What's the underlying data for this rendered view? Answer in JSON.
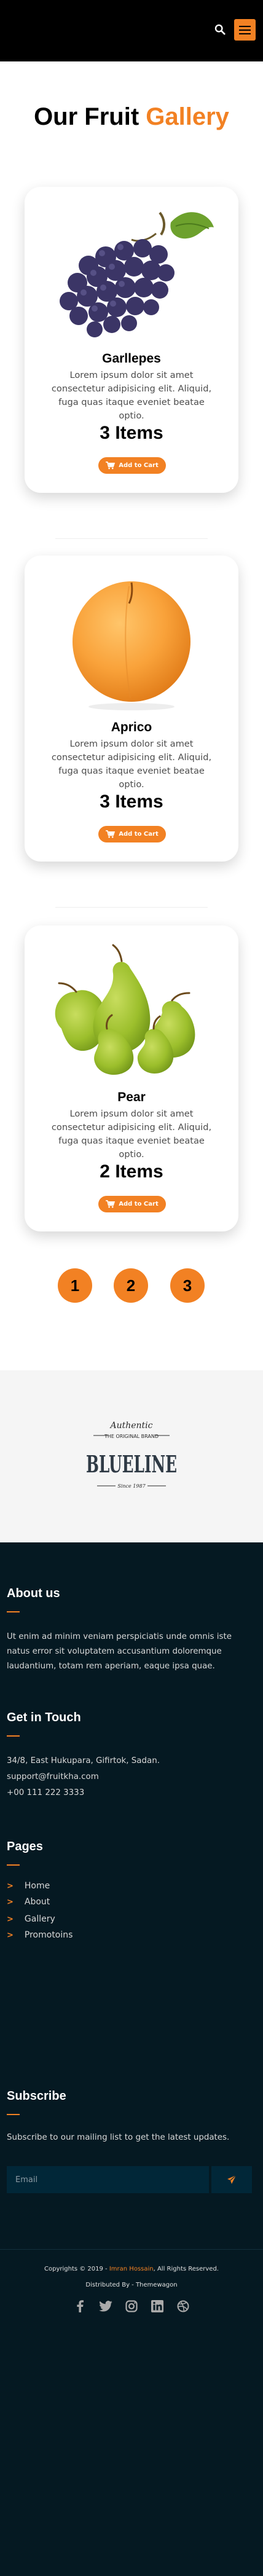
{
  "gallery": {
    "title_main": "Our Fruit ",
    "title_accent": "Gallery"
  },
  "products": [
    {
      "name": "Garllepes",
      "description": "Lorem ipsum dolor sit amet consectetur adipisicing elit. Aliquid, fuga quas itaque eveniet beatae optio.",
      "quantity": "3 Items",
      "button": "Add to Cart",
      "image": "grapes"
    },
    {
      "name": "Aprico",
      "description": "Lorem ipsum dolor sit amet consectetur adipisicing elit. Aliquid, fuga quas itaque eveniet beatae optio.",
      "quantity": "3 Items",
      "button": "Add to Cart",
      "image": "apricot"
    },
    {
      "name": "Pear",
      "description": "Lorem ipsum dolor sit amet consectetur adipisicing elit. Aliquid, fuga quas itaque eveniet beatae optio.",
      "quantity": "2 Items",
      "button": "Add to Cart",
      "image": "pears"
    }
  ],
  "pagination": [
    "1",
    "2",
    "3"
  ],
  "brand": {
    "tagline": "Authentic",
    "subtitle": "THE ORIGINAL BRAND",
    "name": "BLUELINE",
    "since": "Since 1987"
  },
  "footer": {
    "about_title": "About us",
    "about_text": "Ut enim ad minim veniam perspiciatis unde omnis iste natus error sit voluptatem accusantium doloremque laudantium, totam rem aperiam,  eaque ipsa quae.",
    "touch_title": "Get in Touch",
    "address": "34/8, East Hukupara, Gifirtok, Sadan.",
    "email": "support@fruitkha.com",
    "phone": "+00 111 222 3333",
    "pages_title": "Pages",
    "pages": [
      "Home",
      "About",
      "Gallery",
      "Promotoins"
    ],
    "subscribe_title": "Subscribe",
    "subscribe_text": "Subscribe to our mailing list to get the  latest updates.",
    "email_placeholder": "Email",
    "copyright_prefix": "Copyrights © 2019 - ",
    "copyright_name": "Imran Hossain",
    "copyright_suffix": ",  All Rights Reserved.",
    "distributed_prefix": "Distributed By - ",
    "distributed_name": "Themewagon"
  },
  "icons": {
    "search": "search-icon",
    "menu": "hamburger-menu-icon",
    "cart": "cart-icon",
    "send": "paper-plane-icon",
    "socials": [
      "facebook-icon",
      "twitter-icon",
      "instagram-icon",
      "linkedin-icon",
      "dribbble-icon"
    ]
  },
  "colors": {
    "accent": "#F28123",
    "footer_bg": "#051922",
    "header_bg": "#000000"
  }
}
